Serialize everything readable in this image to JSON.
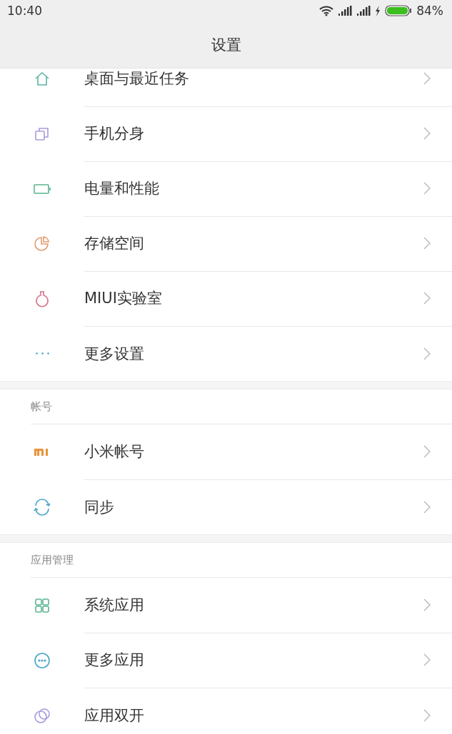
{
  "status_bar": {
    "time": "10:40",
    "battery": "84%"
  },
  "header": {
    "title": "设置"
  },
  "sections": [
    {
      "items": [
        {
          "label": "桌面与最近任务"
        },
        {
          "label": "手机分身"
        },
        {
          "label": "电量和性能"
        },
        {
          "label": "存储空间"
        },
        {
          "label": "MIUI实验室"
        },
        {
          "label": "更多设置"
        }
      ]
    },
    {
      "title": "帐号",
      "items": [
        {
          "label": "小米帐号"
        },
        {
          "label": "同步"
        }
      ]
    },
    {
      "title": "应用管理",
      "items": [
        {
          "label": "系统应用"
        },
        {
          "label": "更多应用"
        },
        {
          "label": "应用双开"
        }
      ]
    }
  ]
}
